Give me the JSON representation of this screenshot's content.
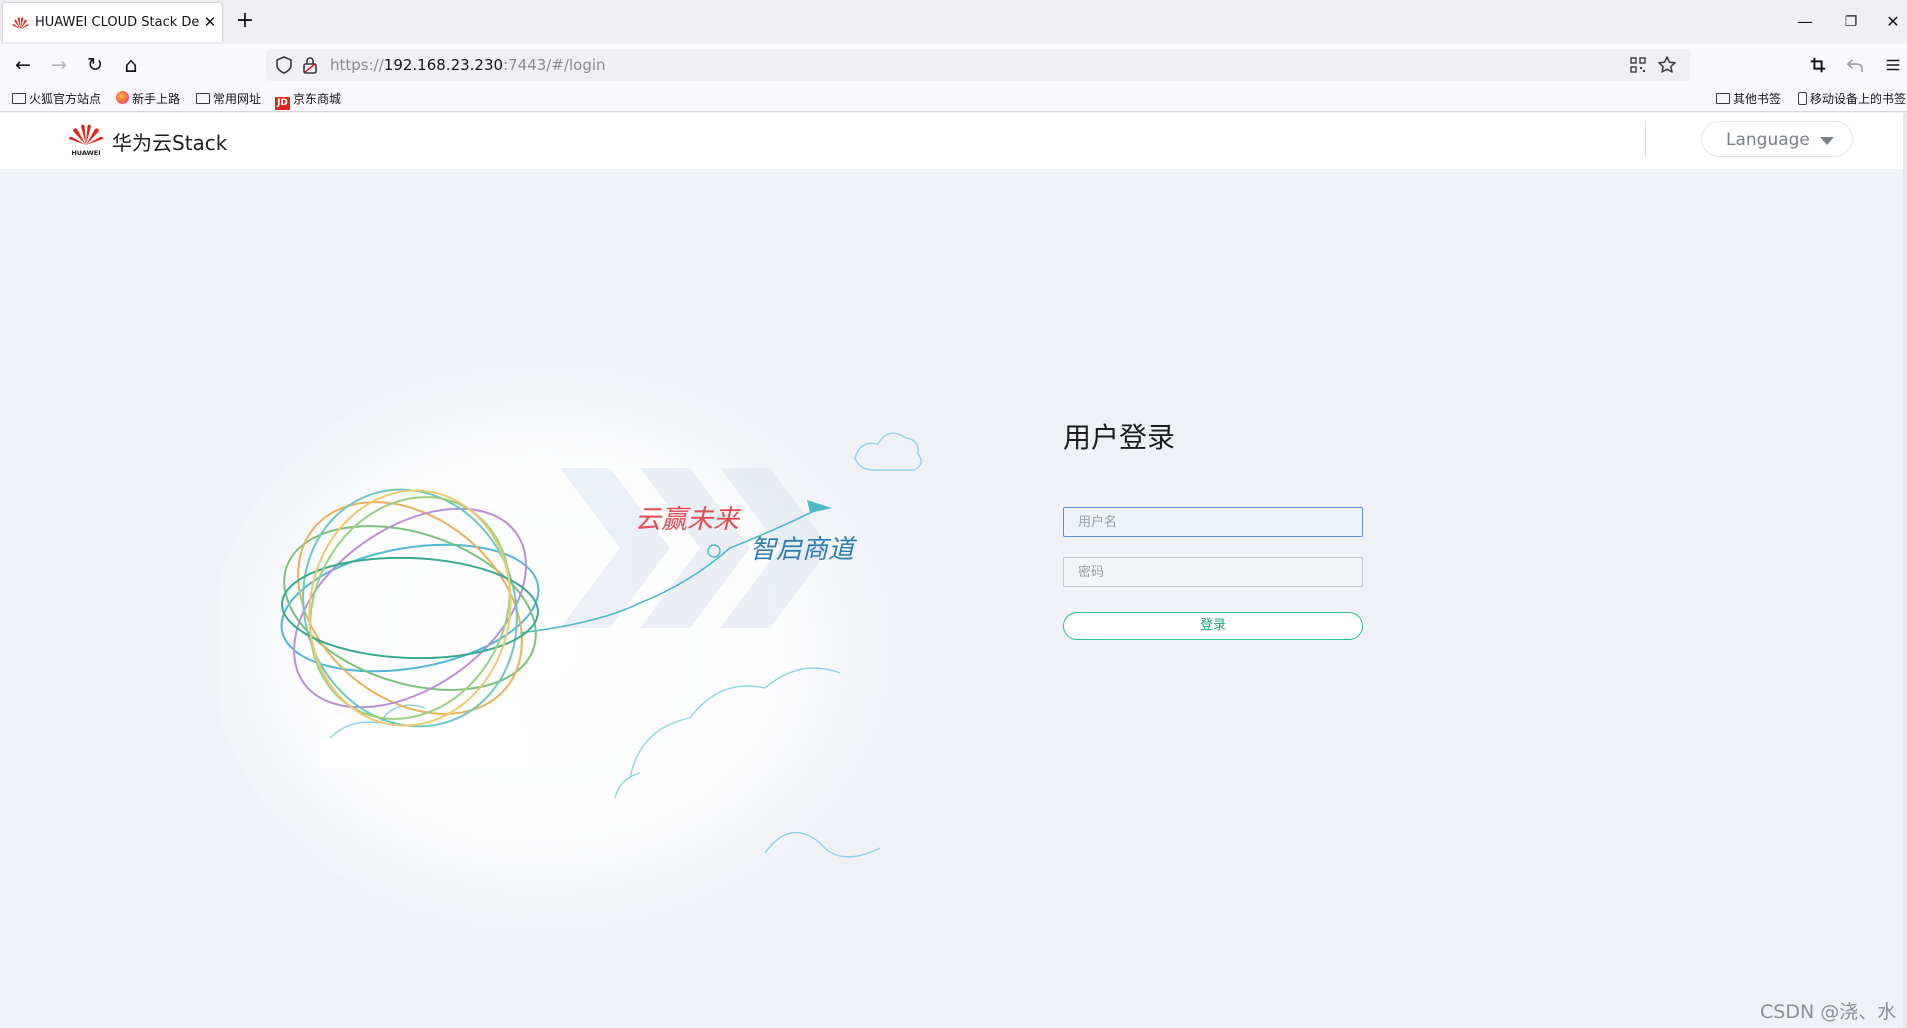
{
  "browser": {
    "tab": {
      "title": "HUAWEI CLOUD Stack Deplo",
      "close_glyph": "✕"
    },
    "new_tab_glyph": "+",
    "window": {
      "minimize": "—",
      "restore": "❐",
      "close": "✕"
    },
    "nav": {
      "back": "←",
      "forward": "→",
      "reload": "↻",
      "home": "⌂"
    },
    "url": {
      "scheme": "https://",
      "host": "192.168.23.230",
      "rest": ":7443/#/login"
    },
    "bookmarks": [
      {
        "label": "火狐官方站点",
        "icon": "folder-icon"
      },
      {
        "label": "新手上路",
        "icon": "firefox-icon"
      },
      {
        "label": "常用网址",
        "icon": "folder-icon"
      },
      {
        "label": "京东商城",
        "icon": "jd-icon"
      }
    ],
    "bookmarks_right": [
      {
        "label": "其他书签",
        "icon": "folder-icon"
      },
      {
        "label": "移动设备上的书签",
        "icon": "phone-icon"
      }
    ],
    "jd_badge": "JD"
  },
  "header": {
    "brand_small": "HUAWEI",
    "product": "华为云Stack",
    "language_label": "Language"
  },
  "illustration": {
    "slogan_1": "云赢未来",
    "slogan_2": "智启商道"
  },
  "login": {
    "title": "用户登录",
    "username_placeholder": "用户名",
    "password_placeholder": "密码",
    "submit_label": "登录"
  },
  "watermark": "CSDN @浇、水",
  "colors": {
    "brand_red": "#e1251b",
    "accent_green": "#2dbf8a",
    "focus_blue": "#5b8fd6",
    "page_bg": "#eef1f6"
  }
}
